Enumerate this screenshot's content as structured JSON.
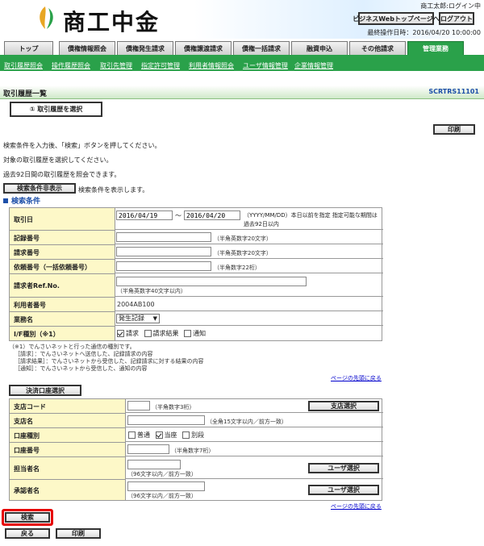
{
  "header": {
    "logo_text": "商工中金",
    "user_login": "商工太郎:ログイン中",
    "biz_top_button": "ビジネスWebトップページへ",
    "logout_button": "ログアウト",
    "last_operation": "最終操作日時：2016/04/20 10:00:00"
  },
  "tabs": [
    {
      "label": "トップ"
    },
    {
      "label": "債権情報照会"
    },
    {
      "label": "債権発生請求"
    },
    {
      "label": "債権譲渡請求"
    },
    {
      "label": "債権一括請求"
    },
    {
      "label": "融資申込"
    },
    {
      "label": "その他請求"
    },
    {
      "label": "管理業務"
    }
  ],
  "submenu": [
    {
      "label": "取引履歴照会"
    },
    {
      "label": "操作履歴照会"
    },
    {
      "label": "取引先管理"
    },
    {
      "label": "指定許可管理"
    },
    {
      "label": "利用者情報照会"
    },
    {
      "label": "ユーザ情報管理"
    },
    {
      "label": "企業情報管理"
    }
  ],
  "page": {
    "title": "取引履歴一覧",
    "screen_id": "SCRTRS11101",
    "step_label": "① 取引履歴を選択",
    "print_button": "印刷",
    "instructions": [
      "検索条件を入力後、「検索」ボタンを押してください。",
      "対象の取引履歴を選択してください。",
      "過去92日間の取引履歴を照会できます。"
    ],
    "hide_conditions_button": "検索条件非表示",
    "hide_conditions_hint": "検索条件を表示します。",
    "section_title": "検索条件"
  },
  "search": {
    "date_label": "取引日",
    "date_from": "2016/04/19",
    "date_sep": "～",
    "date_to": "2016/04/20",
    "date_note": "（YYYY/MM/DD）本日以前を指定 指定可能な期間は過去92日以内",
    "record_no_label": "記録番号",
    "record_no_note": "（半角英数字20文字）",
    "request_no_label": "請求番号",
    "request_no_note": "（半角英数字20文字）",
    "bulk_no_label": "依頼番号（一括依頼番号）",
    "bulk_no_note": "（半角数字22桁）",
    "ref_label": "請求者Ref.No.",
    "ref_note": "（半角英数字40文字以内）",
    "user_no_label": "利用者番号",
    "user_no_value": "2004AB100",
    "task_label": "業務名",
    "task_value": "発生記録",
    "if_label": "I/F種別（※1）",
    "if_opts": [
      {
        "label": "請求",
        "checked": true
      },
      {
        "label": "請求結果",
        "checked": false
      },
      {
        "label": "通知",
        "checked": false
      }
    ],
    "notes": [
      "（※1）でんさいネットと行った通信の種別です。",
      "［請求］：でんさいネットへ送信した、記録請求の内容",
      "［請求結果］：でんさいネットから受信した、記録請求に対する結果の内容",
      "［通知］：でんさいネットから受信した、通知の内容"
    ],
    "back_to_top": "ページの先頭に戻る"
  },
  "account": {
    "select_button": "決済口座選択",
    "branch_code_label": "支店コード",
    "branch_code_note": "（半角数字3桁）",
    "branch_select_button": "支店選択",
    "branch_name_label": "支店名",
    "branch_name_note": "（全角15文字以内／前方一致）",
    "type_label": "口座種別",
    "type_opts": [
      {
        "label": "普通",
        "checked": false
      },
      {
        "label": "当座",
        "checked": true
      },
      {
        "label": "別段",
        "checked": false
      }
    ],
    "acct_no_label": "口座番号",
    "acct_no_note": "（半角数字7桁）",
    "staff_label": "担当者名",
    "staff_note": "（96文字以内／前方一致）",
    "staff_button": "ユーザ選択",
    "approver_label": "承認者名",
    "approver_note": "（96文字以内／前方一致）",
    "approver_button": "ユーザ選択",
    "back_to_top": "ページの先頭に戻る"
  },
  "footer": {
    "search_button": "検索",
    "back_button": "戻る",
    "print_button": "印刷"
  },
  "colors": {
    "brand_green": "#2aa14a",
    "highlight_red": "#e60000",
    "label_bg": "#fdf8c8"
  }
}
